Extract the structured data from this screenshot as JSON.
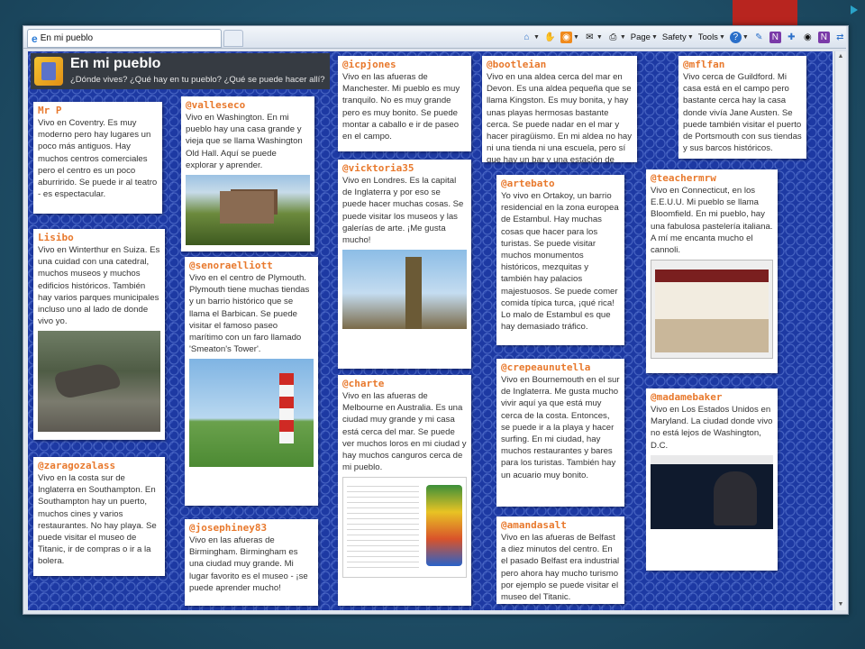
{
  "browser": {
    "tab_title": "En mi pueblo",
    "commands": {
      "page": "Page",
      "safety": "Safety",
      "tools": "Tools"
    }
  },
  "header": {
    "title": "En mi pueblo",
    "subtitle": "¿Dónde vives? ¿Qué hay en tu pueblo? ¿Qué se puede hacer allí?"
  },
  "notes": [
    {
      "name": "Mr P",
      "text": "Vivo en Coventry. Es muy moderno pero hay lugares un poco más antiguos. Hay muchos centros comerciales pero el centro es un poco aburrirido. Se puede ir al teatro - es espectacular."
    },
    {
      "name": "Lisibo",
      "text": "Vivo en Winterthur en Suiza. Es una cuidad con una catedral, muchos museos y muchos edificios históricos. También hay varios parques municipales incluso uno al lado de donde vivo yo."
    },
    {
      "name": "@zaragozalass",
      "text": "Vivo en la costa sur de Inglaterra en Southampton. En Southampton hay un puerto, muchos cines y varios restaurantes.  No hay playa. Se puede visitar el museo de Titanic, ir de compras o ir a la bolera."
    },
    {
      "name": "@valleseco",
      "text": "Vivo en Washington. En mi pueblo hay una casa grande y vieja que se llama Washington Old Hall. Aquí se puede explorar y aprender."
    },
    {
      "name": "@senoraelliott",
      "text": "Vivo en el centro de Plymouth. Plymouth tiene muchas tiendas y un barrio histórico que se llama el Barbican. Se puede visitar el famoso paseo marítimo con un faro llamado 'Smeaton's Tower'."
    },
    {
      "name": "@josephiney83",
      "text": "Vivo en las afueras de Birmingham. Birmingham es una ciudad muy grande. Mi lugar favorito es el museo - ¡se puede aprender mucho!"
    },
    {
      "name": "@icpjones",
      "text": "Vivo en las afueras de Manchester. Mi pueblo es muy tranquilo. No es muy grande pero es muy bonito. Se puede montar a caballo e ir de paseo en el campo."
    },
    {
      "name": "@vicktoria35",
      "text": "Vivo en Londres. Es la capital de Inglaterra y por eso se puede hacer muchas cosas. Se puede visitar los museos y las galerías de arte.  ¡Me gusta mucho!"
    },
    {
      "name": "@charte",
      "text": "Vivo en las afueras de Melbourne en Australia. Es una ciudad muy grande y mi casa está cerca del mar.  Se puede ver muchos loros en mi ciudad y hay muchos canguros cerca de mi pueblo."
    },
    {
      "name": "@bootleian",
      "text": "Vivo en una aldea cerca del mar en Devon. Es una aldea pequeña que se llama Kingston. Es muy bonita, y hay unas playas hermosas bastante cerca. Se puede nadar en el mar y hacer piragüismo. En mi aldea no hay ni una tienda ni una escuela, pero sí que hay un bar y una estación de bomberos."
    },
    {
      "name": "@artebato",
      "text": "Yo vivo en Ortakoy, un barrio residencial en la zona europea de Estambul. Hay muchas cosas que hacer para los turistas. Se puede visitar muchos monumentos históricos, mezquitas y también hay palacios majestuosos. Se puede comer comida típica turca, ¡qué rica! Lo malo de Estambul es que hay demasiado tráfico."
    },
    {
      "name": "@crepeaunutella",
      "text": "Vivo en Bournemouth en el sur de Inglaterra. Me gusta mucho vivir aquí ya que está muy cerca de la costa. Entonces, se puede ir a la playa y hacer surfing. En mi ciudad, hay muchos restaurantes y bares para los turistas. También hay un acuario muy bonito."
    },
    {
      "name": "@amandasalt",
      "text": "Vivo en las afueras de Belfast a diez minutos del centro. En el pasado Belfast era industrial pero ahora hay mucho turismo por ejemplo se puede visitar el museo del Titanic."
    },
    {
      "name": "@mflfan",
      "text": "Vivo cerca de Guildford. Mi casa está en el campo pero bastante cerca hay la casa donde vivía Jane Austen. Se puede también visitar el puerto de Portsmouth con sus tiendas y sus barcos históricos."
    },
    {
      "name": "@teachermrw",
      "text": "Vivo en Connecticut, en los E.E.U.U. Mi pueblo se llama Bloomfield. En mi pueblo, hay una fabulosa pastelería italiana. A mí me encanta mucho el cannoli."
    },
    {
      "name": "@madamebaker",
      "text": "Vivo en Los Estados Unidos en Maryland. La ciudad donde vivo no está lejos de Washington, D.C."
    }
  ]
}
